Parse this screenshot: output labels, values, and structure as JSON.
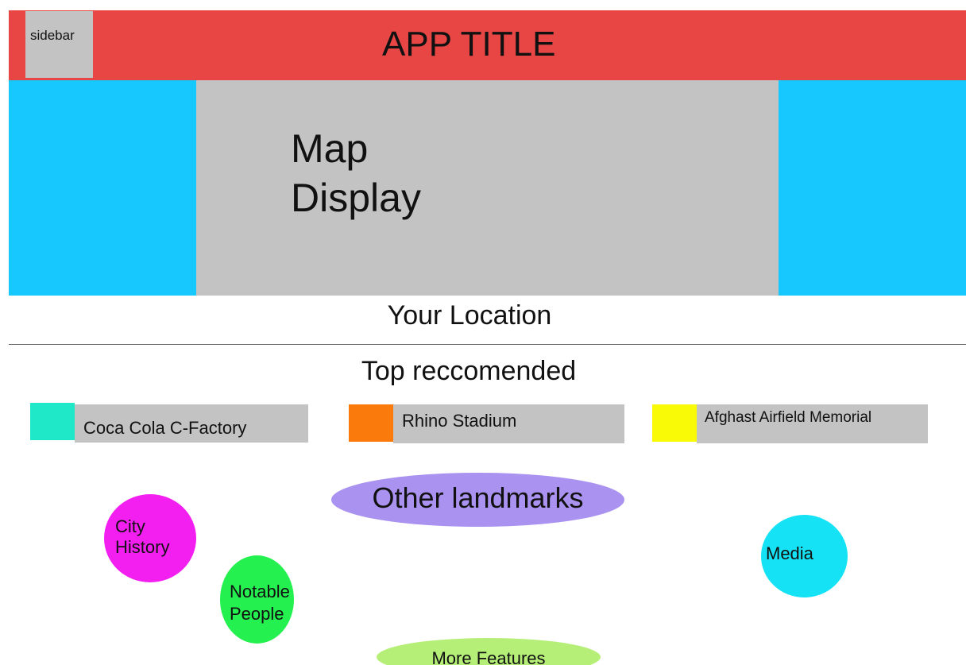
{
  "header": {
    "sidebar_label": "sidebar",
    "title": "APP TITLE"
  },
  "map": {
    "label_line1": "Map",
    "label_line2": "Display"
  },
  "location": {
    "label": "Your Location"
  },
  "recommendations": {
    "heading": "Top reccomended",
    "items": [
      {
        "label": "Coca Cola C-Factory",
        "color": "#1ee8c8"
      },
      {
        "label": "Rhino Stadium",
        "color": "#fa7a0c"
      },
      {
        "label": "Afghast Airfield Memorial",
        "color": "#f9fb06"
      }
    ]
  },
  "features": {
    "other_landmarks": "Other landmarks",
    "city_history_line1": "City",
    "city_history_line2": "History",
    "notable_people_line1": "Notable",
    "notable_people_line2": "People",
    "media": "Media",
    "more_features": "More Features"
  },
  "colors": {
    "header": "#e84545",
    "map_side": "#17c8ff",
    "map_center": "#c3c3c3",
    "other_landmarks": "#aa92f0",
    "city_history": "#f31ff0",
    "notable_people": "#24f04f",
    "media": "#15e2f4",
    "more_features": "#b5ef78"
  }
}
